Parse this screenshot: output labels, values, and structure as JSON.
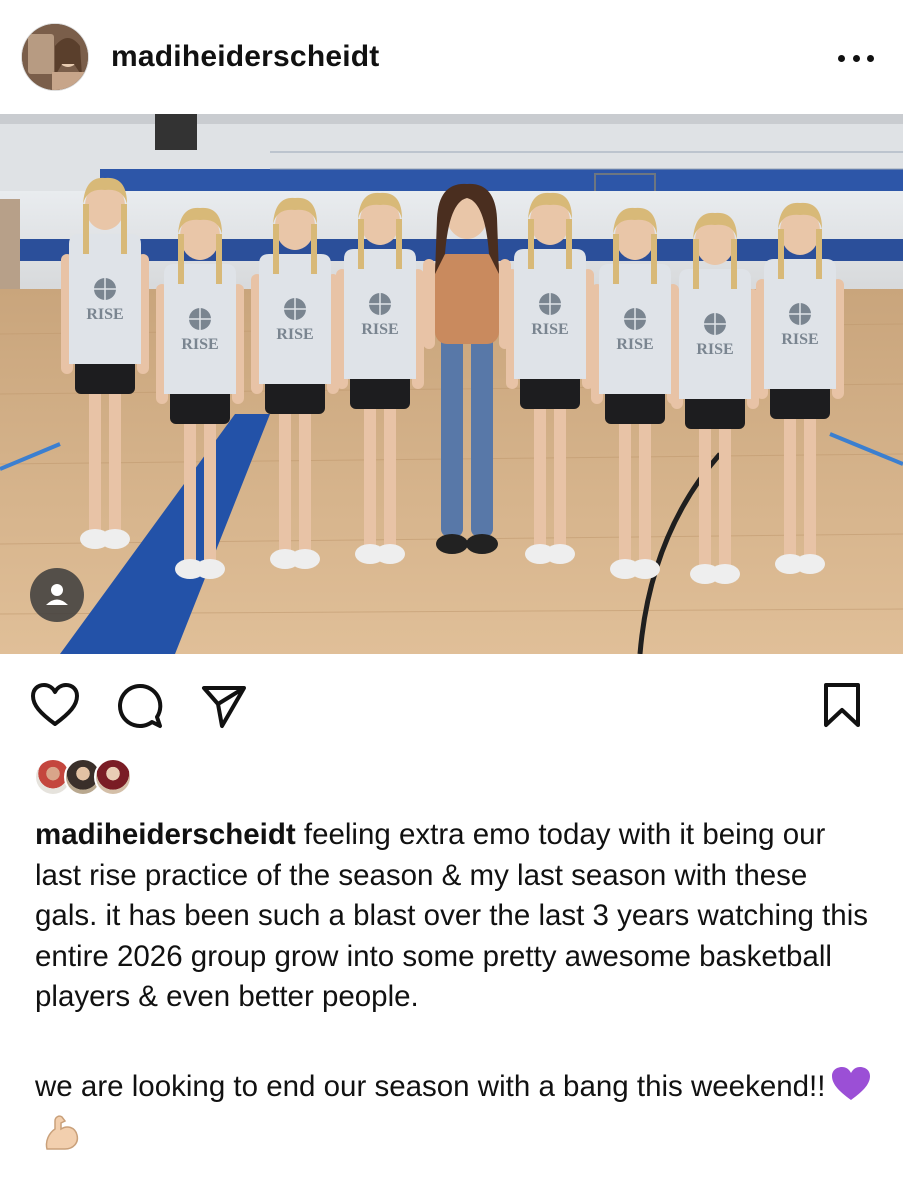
{
  "post": {
    "username": "madiheiderscheidt",
    "caption_username": "madiheiderscheidt",
    "caption_part1": " feeling extra emo today with it being our last rise practice of the season & my last season with these gals. it has been such a blast over the last 3 years watching this entire 2026 group grow into some pretty awesome basketball players & even better people.",
    "caption_part2": "we are looking to end our season with a bang this weekend!!",
    "caption_emojis": [
      "purple-heart",
      "flexed-biceps"
    ],
    "jersey_text": "RISE"
  },
  "icons": {
    "more": "more-options-icon",
    "like": "heart-icon",
    "comment": "comment-bubble-icon",
    "share": "paper-plane-icon",
    "save": "bookmark-icon",
    "tagged_people": "person-icon"
  },
  "colors": {
    "text": "#111111",
    "court_wood": "#d9b48a",
    "court_blue": "#1f4fa0",
    "jersey": "#dfe3e8"
  }
}
